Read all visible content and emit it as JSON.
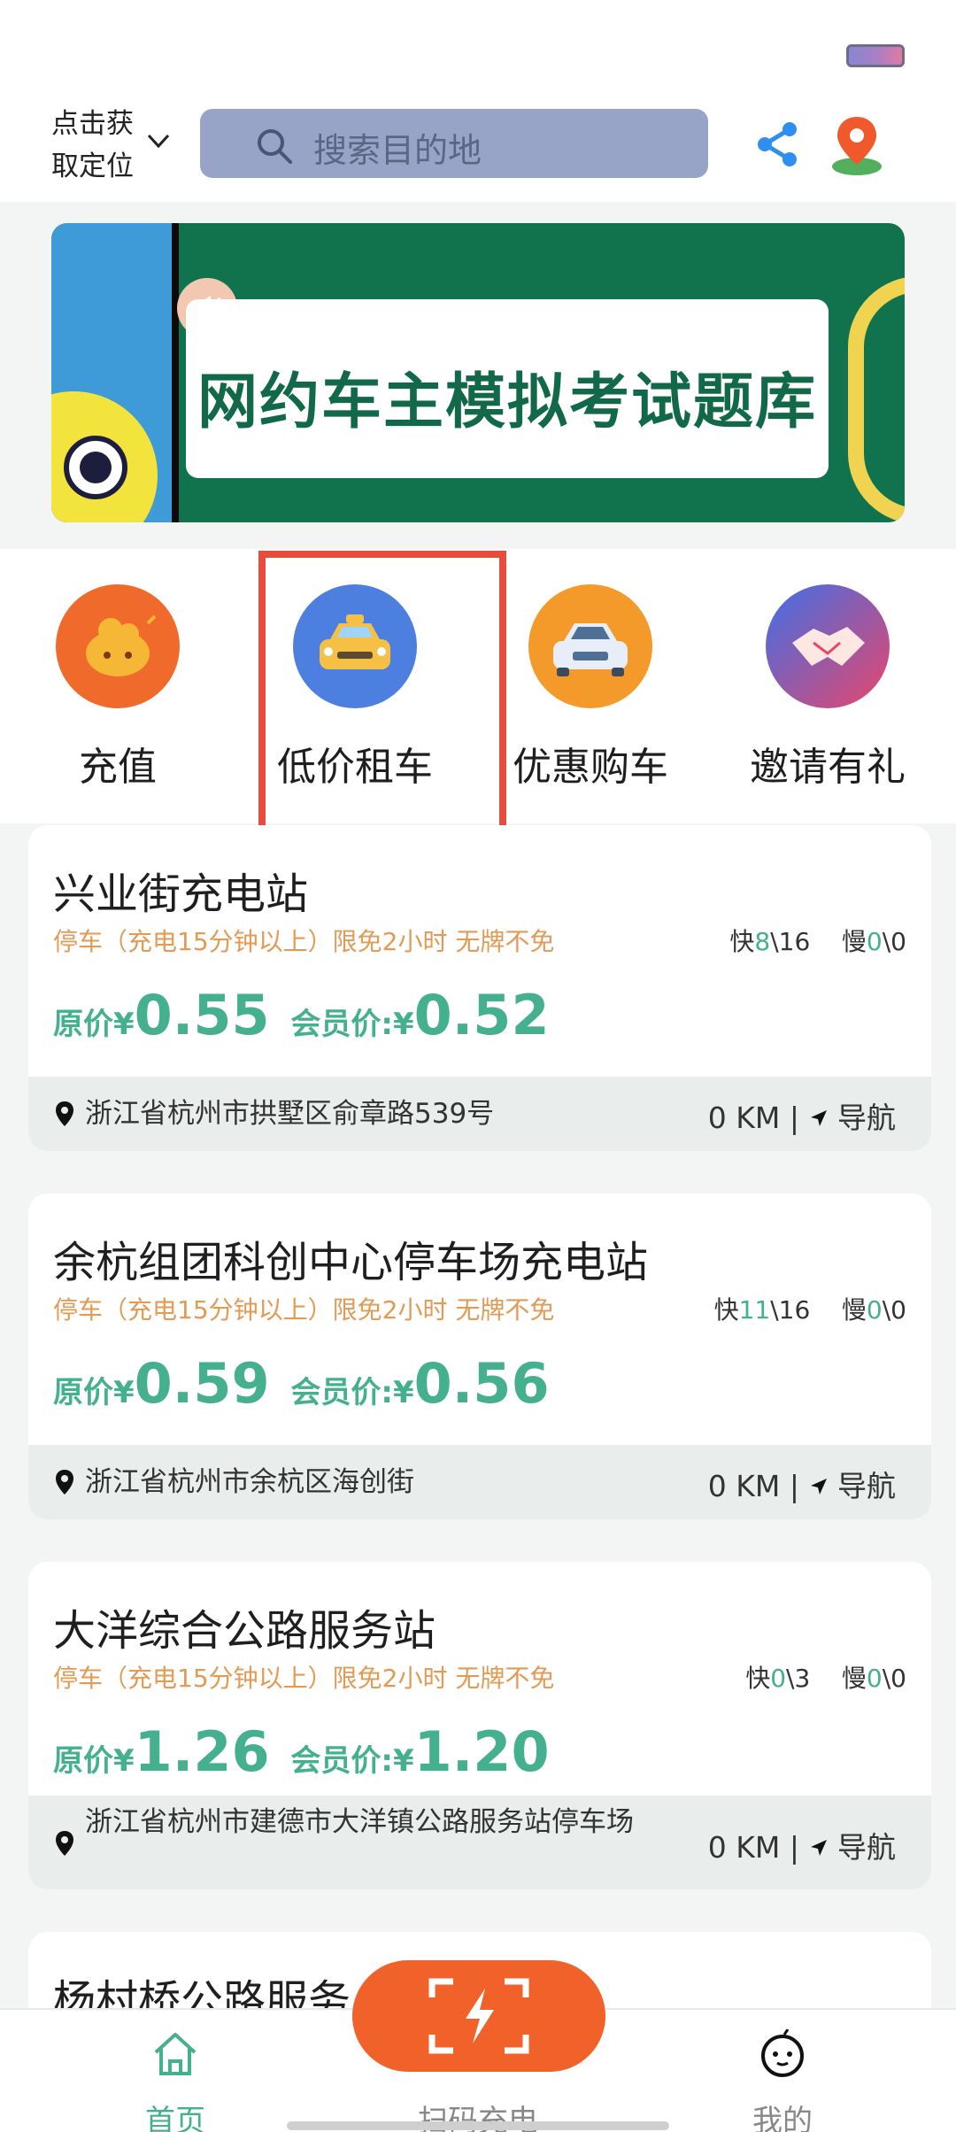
{
  "header": {
    "location_label": "点击获取定位",
    "search_placeholder": "搜索目的地"
  },
  "banner": {
    "title": "网约车主模拟考试题库"
  },
  "quick_actions": [
    {
      "label": "充值",
      "icon": "coin-bag-icon",
      "color": "#ef6a2b"
    },
    {
      "label": "低价租车",
      "icon": "taxi-icon",
      "color": "#4d7fe0"
    },
    {
      "label": "优惠购车",
      "icon": "car-icon",
      "color": "#f39a2a"
    },
    {
      "label": "邀请有礼",
      "icon": "handshake-icon",
      "color": "#e04a6a"
    }
  ],
  "stations": [
    {
      "name": "兴业街充电站",
      "rule": "停车（充电15分钟以上）限免2小时 无牌不免",
      "fast_prefix": "快",
      "fast_available": "8",
      "fast_total": "\\16",
      "slow_prefix": "慢",
      "slow_available": "0",
      "slow_total": "\\0",
      "orig_label": "原价¥",
      "orig_price": "0.55",
      "member_label": "会员价:¥",
      "member_price": "0.52",
      "address": "浙江省杭州市拱墅区俞章路539号",
      "distance": "0 KM |",
      "nav_label": "导航"
    },
    {
      "name": "余杭组团科创中心停车场充电站",
      "rule": "停车（充电15分钟以上）限免2小时 无牌不免",
      "fast_prefix": "快",
      "fast_available": "11",
      "fast_total": "\\16",
      "slow_prefix": "慢",
      "slow_available": "0",
      "slow_total": "\\0",
      "orig_label": "原价¥",
      "orig_price": "0.59",
      "member_label": "会员价:¥",
      "member_price": "0.56",
      "address": "浙江省杭州市余杭区海创街",
      "distance": "0 KM |",
      "nav_label": "导航"
    },
    {
      "name": "大洋综合公路服务站",
      "rule": "停车（充电15分钟以上）限免2小时 无牌不免",
      "fast_prefix": "快",
      "fast_available": "0",
      "fast_total": "\\3",
      "slow_prefix": "慢",
      "slow_available": "0",
      "slow_total": "\\0",
      "orig_label": "原价¥",
      "orig_price": "1.26",
      "member_label": "会员价:¥",
      "member_price": "1.20",
      "address": "浙江省杭州市建德市大洋镇公路服务站停车场",
      "distance": "0 KM |",
      "nav_label": "导航"
    },
    {
      "name": "杨村桥公路服务"
    }
  ],
  "tabbar": {
    "home_label": "首页",
    "scan_label": "扫码充电",
    "mine_label": "我的"
  },
  "colors": {
    "accent_green": "#44b08d",
    "rule_orange": "#e29a55",
    "highlight_red": "#e74c3c",
    "scan_orange": "#f0622a"
  }
}
